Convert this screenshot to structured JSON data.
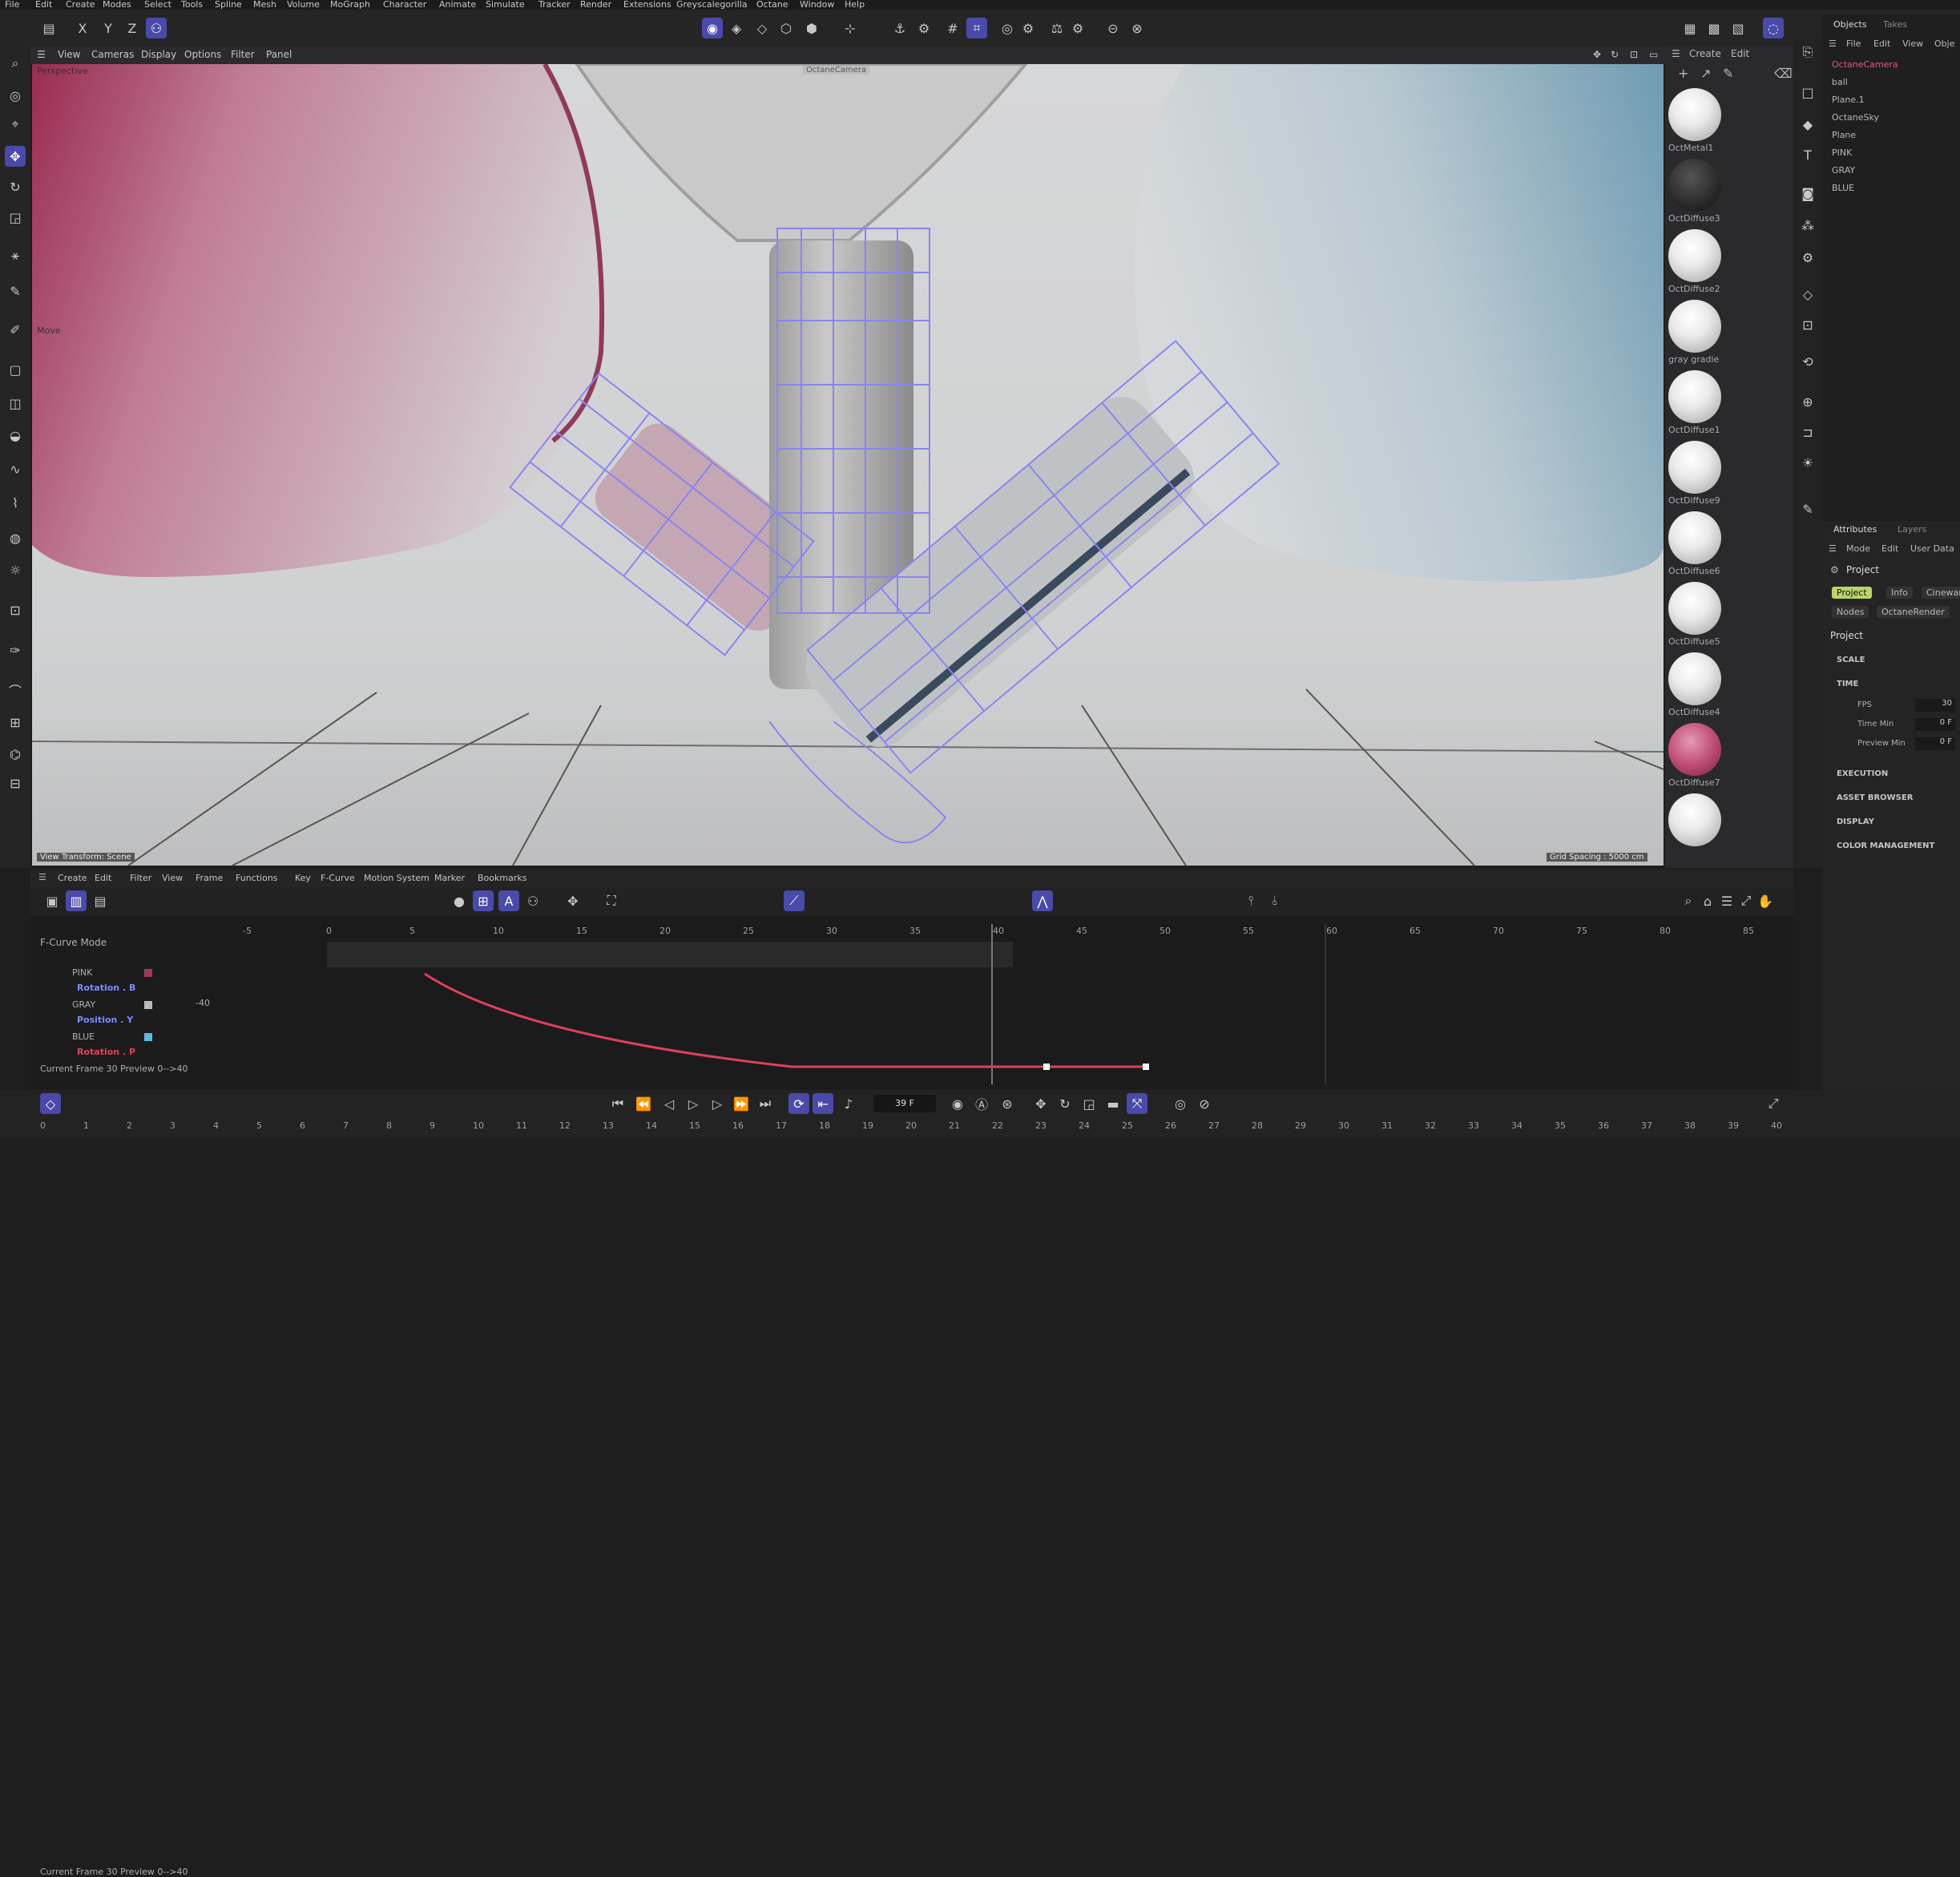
{
  "menu": [
    "File",
    "Edit",
    "Create",
    "Modes",
    "Select",
    "Tools",
    "Spline",
    "Mesh",
    "Volume",
    "MoGraph",
    "Character",
    "Animate",
    "Simulate",
    "Tracker",
    "Render",
    "Extensions",
    "Greyscalegorilla",
    "Octane",
    "Window",
    "Help"
  ],
  "axis_toggles": [
    "X",
    "Y",
    "Z"
  ],
  "viewport": {
    "menu": [
      "View",
      "Cameras",
      "Display",
      "Options",
      "Filter",
      "Panel"
    ],
    "camera_label": "Perspective",
    "tool_label": "Move",
    "octane_camera_tag": "OctaneCamera",
    "bottom_left": "View Transform: Scene",
    "bottom_right": "Grid Spacing : 5000 cm"
  },
  "material_panel": {
    "menu": [
      "Create",
      "Edit"
    ],
    "materials": [
      {
        "name": "OctMetal1"
      },
      {
        "name": "OctDiffuse3"
      },
      {
        "name": "OctDiffuse2"
      },
      {
        "name": "gray gradie"
      },
      {
        "name": "OctDiffuse1"
      },
      {
        "name": "OctDiffuse9"
      },
      {
        "name": "OctDiffuse6"
      },
      {
        "name": "OctDiffuse5"
      },
      {
        "name": "OctDiffuse4"
      },
      {
        "name": "OctDiffuse7"
      },
      {
        "name": ""
      }
    ]
  },
  "objects_panel": {
    "tabs": [
      "Objects",
      "Takes"
    ],
    "menu": [
      "File",
      "Edit",
      "View",
      "Obje"
    ],
    "items": [
      "OctaneCamera",
      "ball",
      "Plane.1",
      "OctaneSky",
      "Plane",
      "PINK",
      "GRAY",
      "BLUE"
    ]
  },
  "attributes_panel": {
    "tabs": [
      "Attributes",
      "Layers"
    ],
    "menu": [
      "Mode",
      "Edit",
      "User Data"
    ],
    "title": "Project",
    "subtabs": [
      "Project",
      "Info",
      "Cinewar"
    ],
    "subtabs2": [
      "Nodes",
      "OctaneRender"
    ],
    "section": "Project",
    "groups": [
      "SCALE",
      "TIME",
      "EXECUTION",
      "ASSET BROWSER",
      "DISPLAY",
      "COLOR MANAGEMENT"
    ],
    "time_fields": [
      {
        "label": "FPS",
        "value": "30"
      },
      {
        "label": "Time Min",
        "value": "0 F"
      },
      {
        "label": "Preview Min",
        "value": "0 F"
      }
    ]
  },
  "timeline": {
    "menu": [
      "Create",
      "Edit",
      "Filter",
      "View",
      "Frame",
      "Functions",
      "Key",
      "F-Curve",
      "Motion System",
      "Marker",
      "Bookmarks"
    ],
    "mode_label": "F-Curve Mode",
    "ruler": [
      "-5",
      "0",
      "5",
      "10",
      "15",
      "20",
      "25",
      "30",
      "35",
      "40",
      "45",
      "50",
      "55",
      "60",
      "65",
      "70",
      "75",
      "80",
      "85"
    ],
    "tracks": [
      {
        "name": "PINK",
        "sub": "Rotation . B"
      },
      {
        "name": "GRAY",
        "sub": "Position . Y"
      },
      {
        "name": "BLUE",
        "sub": "Rotation . P"
      }
    ],
    "value_readout": "-40",
    "status": "Current Frame  30  Preview  0-->40"
  },
  "playback": {
    "frame_field": "39 F",
    "ruler": [
      "0",
      "1",
      "2",
      "3",
      "4",
      "5",
      "6",
      "7",
      "8",
      "9",
      "10",
      "11",
      "12",
      "13",
      "14",
      "15",
      "16",
      "17",
      "18",
      "19",
      "20",
      "21",
      "22",
      "23",
      "24",
      "25",
      "26",
      "27",
      "28",
      "29",
      "30",
      "31",
      "32",
      "33",
      "34",
      "35",
      "36",
      "37",
      "38",
      "39",
      "40"
    ]
  },
  "colors": {
    "accent": "#4a4aa8",
    "curve": "#e0405a",
    "wire": "#8a84f0",
    "pink": "#9c3a5e",
    "blue": "#5fb7e0"
  }
}
